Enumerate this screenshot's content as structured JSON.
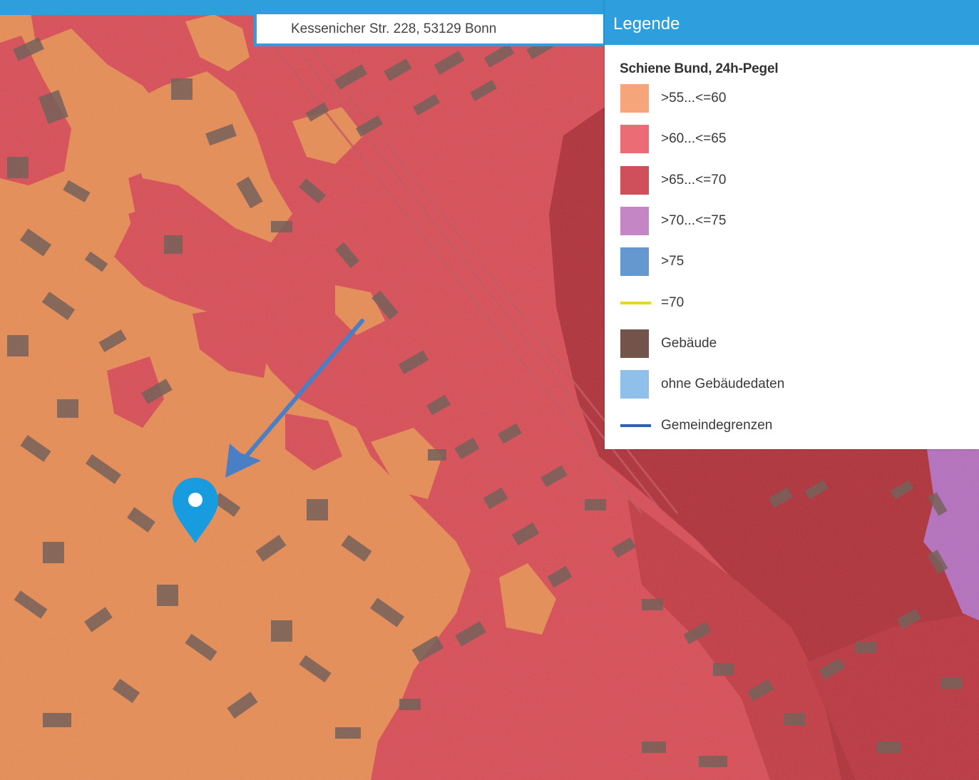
{
  "search": {
    "address": "Kessenicher Str. 228, 53129 Bonn"
  },
  "legend": {
    "title": "Legende",
    "subtitle": "Schiene Bund, 24h-Pegel",
    "items": [
      {
        "label": ">55...<=60",
        "color": "#f6a57b",
        "kind": "box"
      },
      {
        "label": ">60...<=65",
        "color": "#ec6c76",
        "kind": "box"
      },
      {
        "label": ">65...<=70",
        "color": "#cf505a",
        "kind": "box"
      },
      {
        "label": ">70...<=75",
        "color": "#c586c5",
        "kind": "box"
      },
      {
        "label": ">75",
        "color": "#6598cf",
        "kind": "box"
      },
      {
        "label": "=70",
        "color": "#e6d923",
        "kind": "line"
      },
      {
        "label": "Gebäude",
        "color": "#72544a",
        "kind": "box"
      },
      {
        "label": "ohne Gebäudedaten",
        "color": "#8fc0ea",
        "kind": "box"
      },
      {
        "label": "Gemeindegrenzen",
        "color": "#2f62b4",
        "kind": "line"
      }
    ]
  },
  "map": {
    "zones": {
      "level_55_60": "#e88c54",
      "level_60_65": "#d94c55",
      "level_65_70": "#b02f38",
      "level_70_75": "#b56fbe"
    },
    "marker_color": "#199cdf",
    "arrow_color": "#4a7fc6",
    "building_color": "#6f5a52"
  }
}
